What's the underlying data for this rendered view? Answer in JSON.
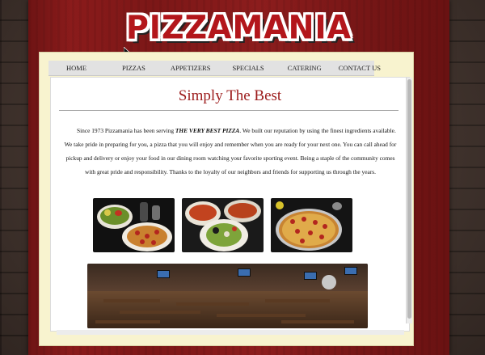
{
  "brand": {
    "logo_text": "PIZZAMANIA"
  },
  "nav": {
    "items": [
      {
        "label": "HOME"
      },
      {
        "label": "PIZZAS"
      },
      {
        "label": "APPETIZERS"
      },
      {
        "label": "SPECIALS"
      },
      {
        "label": "CATERING"
      },
      {
        "label": "CONTACT US"
      }
    ]
  },
  "main": {
    "title": "Simply The Best",
    "intro_before": "Since 1973 Pizzamania has been serving ",
    "intro_emphasis": "THE VERY BEST PIZZA",
    "intro_after": ". We built our reputation by using the finest ingredients available. We take pride in preparing for you, a pizza that you will enjoy and remember when you are ready for your next one. You can call ahead for pickup and delivery or enjoy your food in our dining room watching your favorite sporting event. Being a staple of the community comes with great pride and responsibility. Thanks to the loyalty of our neighbors and friends for supporting us through the years."
  },
  "colors": {
    "accent": "#9c1b1b",
    "panel": "#8a1b1b",
    "frame": "#f8f3cf",
    "nav_bg": "#e2e2e2"
  },
  "icons": {
    "cursor": "arrow-cursor-icon"
  }
}
